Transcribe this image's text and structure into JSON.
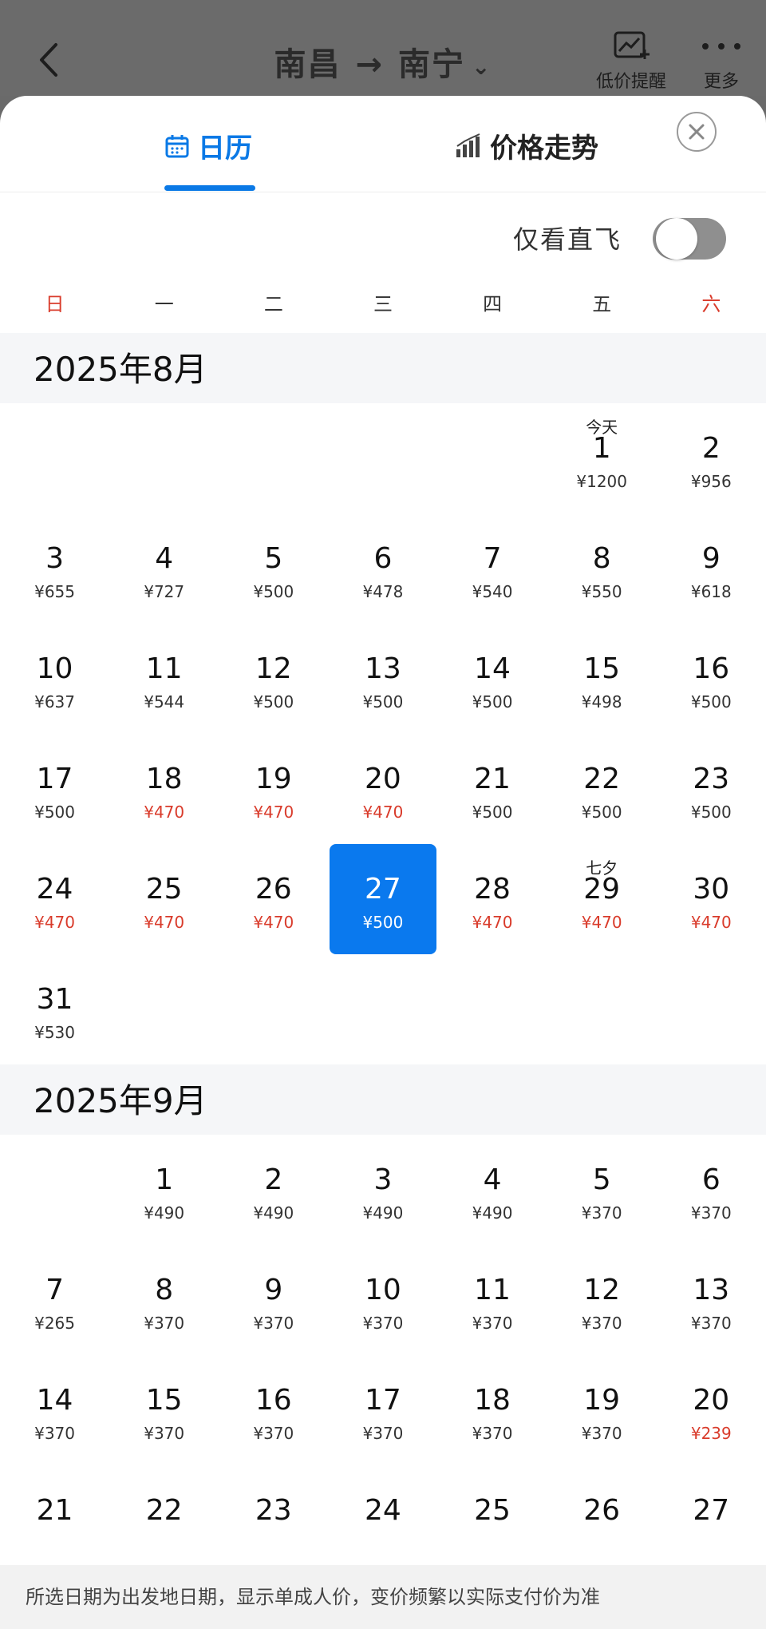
{
  "topbar": {
    "origin": "南昌",
    "destination": "南宁",
    "low_price_alert_label": "低价提醒",
    "more_label": "更多"
  },
  "tabs": {
    "calendar": "日历",
    "trend": "价格走势"
  },
  "filter": {
    "direct_only_label": "仅看直飞",
    "direct_only_on": false
  },
  "weekdays": [
    "日",
    "一",
    "二",
    "三",
    "四",
    "五",
    "六"
  ],
  "months": [
    {
      "title": "2025年8月",
      "leading_blanks": 5,
      "days": [
        {
          "day": "1",
          "price": "¥1200",
          "festival": "今天"
        },
        {
          "day": "2",
          "price": "¥956"
        },
        {
          "day": "3",
          "price": "¥655"
        },
        {
          "day": "4",
          "price": "¥727"
        },
        {
          "day": "5",
          "price": "¥500"
        },
        {
          "day": "6",
          "price": "¥478"
        },
        {
          "day": "7",
          "price": "¥540"
        },
        {
          "day": "8",
          "price": "¥550"
        },
        {
          "day": "9",
          "price": "¥618"
        },
        {
          "day": "10",
          "price": "¥637"
        },
        {
          "day": "11",
          "price": "¥544"
        },
        {
          "day": "12",
          "price": "¥500"
        },
        {
          "day": "13",
          "price": "¥500"
        },
        {
          "day": "14",
          "price": "¥500"
        },
        {
          "day": "15",
          "price": "¥498"
        },
        {
          "day": "16",
          "price": "¥500"
        },
        {
          "day": "17",
          "price": "¥500"
        },
        {
          "day": "18",
          "price": "¥470",
          "low": true
        },
        {
          "day": "19",
          "price": "¥470",
          "low": true
        },
        {
          "day": "20",
          "price": "¥470",
          "low": true
        },
        {
          "day": "21",
          "price": "¥500"
        },
        {
          "day": "22",
          "price": "¥500"
        },
        {
          "day": "23",
          "price": "¥500"
        },
        {
          "day": "24",
          "price": "¥470",
          "low": true
        },
        {
          "day": "25",
          "price": "¥470",
          "low": true
        },
        {
          "day": "26",
          "price": "¥470",
          "low": true
        },
        {
          "day": "27",
          "price": "¥500",
          "selected": true
        },
        {
          "day": "28",
          "price": "¥470",
          "low": true
        },
        {
          "day": "29",
          "price": "¥470",
          "low": true,
          "festival": "七夕"
        },
        {
          "day": "30",
          "price": "¥470",
          "low": true
        },
        {
          "day": "31",
          "price": "¥530"
        }
      ]
    },
    {
      "title": "2025年9月",
      "leading_blanks": 1,
      "days": [
        {
          "day": "1",
          "price": "¥490"
        },
        {
          "day": "2",
          "price": "¥490"
        },
        {
          "day": "3",
          "price": "¥490"
        },
        {
          "day": "4",
          "price": "¥490"
        },
        {
          "day": "5",
          "price": "¥370"
        },
        {
          "day": "6",
          "price": "¥370"
        },
        {
          "day": "7",
          "price": "¥265"
        },
        {
          "day": "8",
          "price": "¥370"
        },
        {
          "day": "9",
          "price": "¥370"
        },
        {
          "day": "10",
          "price": "¥370"
        },
        {
          "day": "11",
          "price": "¥370"
        },
        {
          "day": "12",
          "price": "¥370"
        },
        {
          "day": "13",
          "price": "¥370"
        },
        {
          "day": "14",
          "price": "¥370"
        },
        {
          "day": "15",
          "price": "¥370"
        },
        {
          "day": "16",
          "price": "¥370"
        },
        {
          "day": "17",
          "price": "¥370"
        },
        {
          "day": "18",
          "price": "¥370"
        },
        {
          "day": "19",
          "price": "¥370"
        },
        {
          "day": "20",
          "price": "¥239",
          "low": true
        },
        {
          "day": "21",
          "price": ""
        },
        {
          "day": "22",
          "price": ""
        },
        {
          "day": "23",
          "price": ""
        },
        {
          "day": "24",
          "price": ""
        },
        {
          "day": "25",
          "price": ""
        },
        {
          "day": "26",
          "price": ""
        },
        {
          "day": "27",
          "price": ""
        }
      ]
    }
  ],
  "footer": {
    "note": "所选日期为出发地日期，显示单成人价，变价频繁以实际支付价为准"
  },
  "colors": {
    "accent": "#0a79ee",
    "low_price": "#d93b2b",
    "weekend_header": "#d93b2b"
  }
}
